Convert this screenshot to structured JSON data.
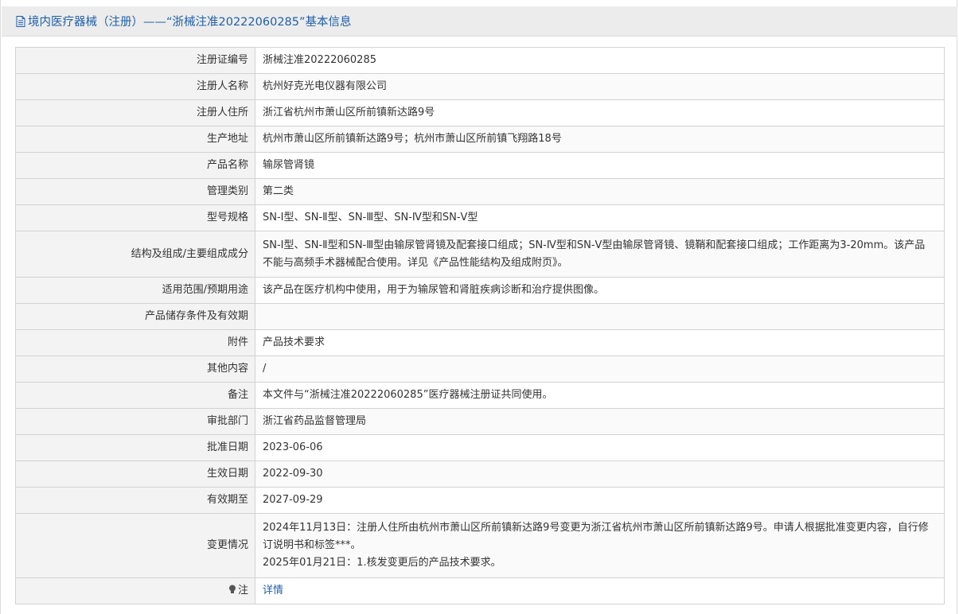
{
  "header": {
    "title": "境内医疗器械（注册）——“浙械注准20222060285”基本信息"
  },
  "rows": [
    {
      "label": "注册证编号",
      "value": "浙械注准20222060285"
    },
    {
      "label": "注册人名称",
      "value": "杭州好克光电仪器有限公司"
    },
    {
      "label": "注册人住所",
      "value": "浙江省杭州市萧山区所前镇新达路9号"
    },
    {
      "label": "生产地址",
      "value": "杭州市萧山区所前镇新达路9号；杭州市萧山区所前镇飞翔路18号"
    },
    {
      "label": "产品名称",
      "value": "输尿管肾镜"
    },
    {
      "label": "管理类别",
      "value": "第二类"
    },
    {
      "label": "型号规格",
      "value": "SN-Ⅰ型、SN-Ⅱ型、SN-Ⅲ型、SN-Ⅳ型和SN-Ⅴ型"
    },
    {
      "label": "结构及组成/主要组成成分",
      "value": "SN-Ⅰ型、SN-Ⅱ型和SN-Ⅲ型由输尿管肾镜及配套接口组成；SN-Ⅳ型和SN-Ⅴ型由输尿管肾镜、镜鞘和配套接口组成；工作距离为3-20mm。该产品不能与高频手术器械配合使用。详见《产品性能结构及组成附页》。"
    },
    {
      "label": "适用范围/预期用途",
      "value": "该产品在医疗机构中使用，用于为输尿管和肾脏疾病诊断和治疗提供图像。"
    },
    {
      "label": "产品储存条件及有效期",
      "value": ""
    },
    {
      "label": "附件",
      "value": "产品技术要求"
    },
    {
      "label": "其他内容",
      "value": "/"
    },
    {
      "label": "备注",
      "value": "本文件与“浙械注准20222060285”医疗器械注册证共同使用。"
    },
    {
      "label": "审批部门",
      "value": "浙江省药品监督管理局"
    },
    {
      "label": "批准日期",
      "value": "2023-06-06"
    },
    {
      "label": "生效日期",
      "value": "2022-09-30"
    },
    {
      "label": "有效期至",
      "value": "2027-09-29"
    },
    {
      "label": "变更情况",
      "value_lines": [
        "2024年11月13日：注册人住所由杭州市萧山区所前镇新达路9号变更为浙江省杭州市萧山区所前镇新达路9号。申请人根据批准变更内容，自行修订说明书和标签***。",
        "2025年01月21日：1.核发变更后的产品技术要求。"
      ]
    },
    {
      "label": "注",
      "value": "详情"
    }
  ],
  "icons": {
    "header_icon": "document-icon",
    "note_icon": "lightbulb-icon"
  },
  "colors": {
    "link": "#1f5fa8",
    "label_bg": "#f3f3f3",
    "header_bg": "#ececec"
  }
}
